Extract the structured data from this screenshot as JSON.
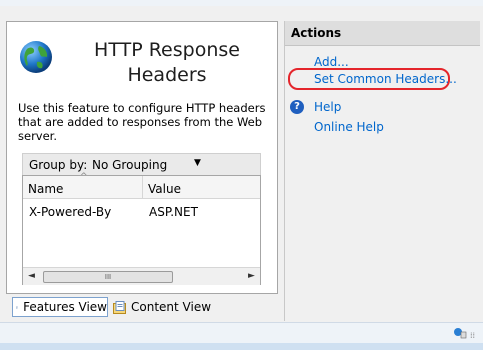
{
  "feature": {
    "title_line1": "HTTP Response",
    "title_line2": "Headers",
    "description": "Use this feature to configure HTTP headers that are added to responses from the Web server.",
    "icon": "globe-icon"
  },
  "groupby": {
    "label": "Group by:",
    "value": "No Grouping"
  },
  "grid": {
    "columns": [
      "Name",
      "Value"
    ],
    "rows": [
      {
        "name": "X-Powered-By",
        "value": "ASP.NET"
      }
    ],
    "scroll_thumb": "III"
  },
  "view_tabs": [
    {
      "label": "Features View",
      "selected": true
    },
    {
      "label": "Content View",
      "selected": false
    }
  ],
  "actions": {
    "header": "Actions",
    "add": "Add...",
    "set_common_headers": "Set Common Headers...",
    "help": "Help",
    "online_help": "Online Help"
  },
  "colors": {
    "link": "#0066cc",
    "highlight": "#e4252b",
    "pane_border": "#a6a6a6"
  }
}
